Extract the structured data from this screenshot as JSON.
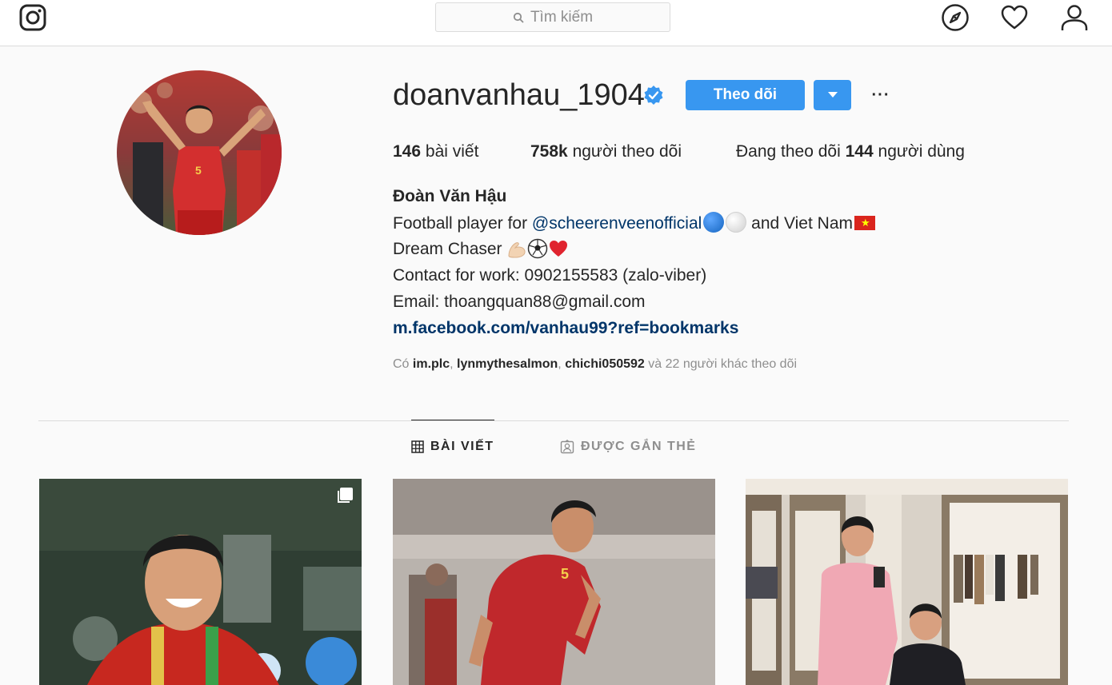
{
  "header": {
    "search_placeholder": "Tìm kiếm",
    "icons": [
      "instagram-logo-icon",
      "search-icon",
      "compass-icon",
      "heart-icon",
      "user-icon"
    ]
  },
  "profile": {
    "username": "doanvanhau_1904",
    "verified": true,
    "follow_label": "Theo dõi",
    "more_label": "···"
  },
  "stats": {
    "posts_count": "146",
    "posts_label": "bài viết",
    "followers_count": "758k",
    "followers_label": "người theo dõi",
    "following_prefix": "Đang theo dõi",
    "following_count": "144",
    "following_label": "người dùng"
  },
  "bio": {
    "full_name": "Đoàn Văn Hậu",
    "line1_prefix": "Football player for ",
    "line1_mention": "@scheerenveenofficial",
    "line1_suffix": " and Viet Nam",
    "line2": "Dream Chaser",
    "line3": "Contact for work: 0902155583 (zalo-viber)",
    "line4": "Email: thoangquan88@gmail.com",
    "link": "m.facebook.com/vanhau99?ref=bookmarks"
  },
  "followed_by": {
    "prefix": "Có",
    "user1": "im.plc",
    "user2": "lynmythesalmon",
    "user3": "chichi050592",
    "suffix": "và 22 người khác theo dõi"
  },
  "tabs": {
    "posts": "BÀI VIẾT",
    "tagged": "ĐƯỢC GẮN THẺ",
    "active": "posts"
  },
  "colors": {
    "accent": "#3897f0",
    "link": "#003569",
    "text": "#262626",
    "muted": "#8e8e8e",
    "border": "#dbdbdb"
  }
}
